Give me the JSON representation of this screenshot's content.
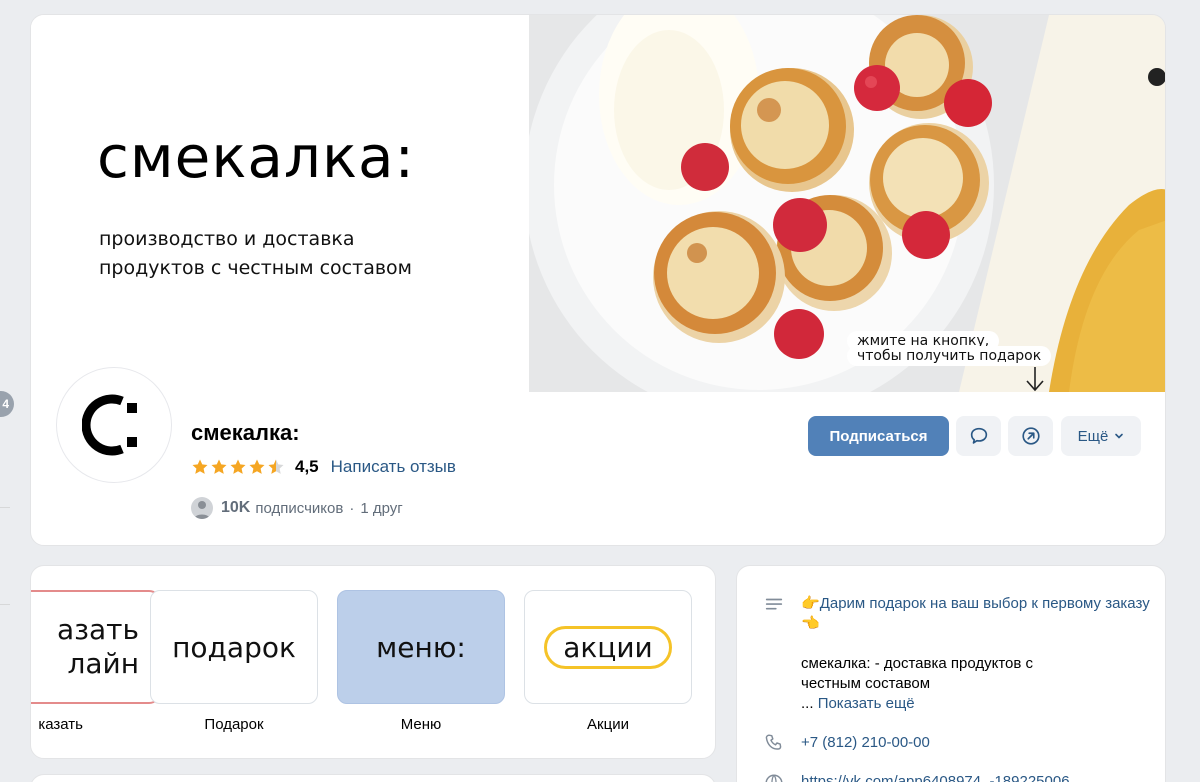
{
  "page": {
    "edge_badge": "4"
  },
  "cover": {
    "brand_word": "смекалка:",
    "tagline_line1": "производство и доставка",
    "tagline_line2": "продуктов с честным составом",
    "bubble_line1": "жмите на кнопку,",
    "bubble_line2": "чтобы получить подарок",
    "photo_subject": "сырники с малиной и сметаной"
  },
  "group": {
    "name": "смекалка:",
    "rating": "4,5",
    "rating_stars": 4.5,
    "review_link": "Написать отзыв",
    "subscribers_count": "10K",
    "subscribers_label": "подписчиков",
    "separator": "·",
    "friends": "1 друг"
  },
  "actions": {
    "subscribe": "Подписаться",
    "message_icon": "message-icon",
    "share_icon": "share-arrow-icon",
    "more": "Ещё"
  },
  "menu": {
    "tiles": [
      {
        "art_line1": "азать",
        "art_line2": "лайн",
        "caption": "казать"
      },
      {
        "art": "подарок",
        "caption": "Подарок"
      },
      {
        "art": "меню:",
        "caption": "Меню"
      },
      {
        "art": "акции",
        "caption": "Акции"
      }
    ]
  },
  "info": {
    "promo_emoji_left": "👉",
    "promo": "Дарим подарок на ваш выбор к первому заказу",
    "promo_emoji_right": "👈",
    "description_line1": "смекалка: - доставка продуктов с",
    "description_line2": "честным составом",
    "ellipsis": "...",
    "show_more": "Показать ещё",
    "phone": "+7 (812) 210-00-00",
    "website": "https://vk.com/app6408974_-189225006"
  },
  "colors": {
    "accent": "#5181b8",
    "link": "#2a5885",
    "star": "#f5a623",
    "menu_tile": "#bccfea",
    "akcii_pill": "#f5c328",
    "page_bg": "#ebedf0"
  }
}
